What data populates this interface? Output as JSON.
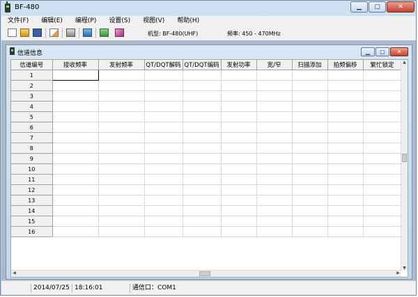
{
  "window": {
    "title": "BF-480"
  },
  "menu": [
    "文件(F)",
    "编辑(E)",
    "编程(P)",
    "设置(S)",
    "视图(V)",
    "帮助(H)"
  ],
  "toolbar": {
    "model_label": "机型: BF-480(UHF)",
    "freq_label": "频率: 450 - 470MHz"
  },
  "child": {
    "title": "信道信息"
  },
  "table": {
    "headers": [
      "信道编号",
      "接收频率",
      "发射频率",
      "QT/DQT解码",
      "QT/DQT编码",
      "发射功率",
      "宽/窄",
      "扫描添加",
      "拍频偏移",
      "繁忙锁定"
    ],
    "rows": [
      "1",
      "2",
      "3",
      "4",
      "5",
      "6",
      "7",
      "8",
      "9",
      "10",
      "11",
      "12",
      "13",
      "14",
      "15",
      "16"
    ]
  },
  "status": {
    "date": "2014/07/25",
    "time": "18:16:01",
    "port": "通信口：COM1"
  }
}
